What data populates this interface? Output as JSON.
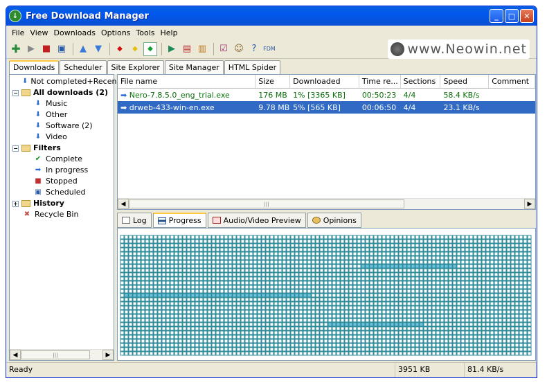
{
  "window": {
    "title": "Free Download Manager"
  },
  "menu": [
    "File",
    "View",
    "Downloads",
    "Options",
    "Tools",
    "Help"
  ],
  "watermark": "www.Neowin.net",
  "tabs": [
    "Downloads",
    "Scheduler",
    "Site Explorer",
    "Site Manager",
    "HTML Spider"
  ],
  "tree": [
    {
      "label": "Not completed+Recen",
      "icon": "download-arrow-icon",
      "level": 1,
      "bold": false
    },
    {
      "label": "All downloads (2)",
      "icon": "folder-icon",
      "level": 0,
      "bold": true,
      "expander": "−"
    },
    {
      "label": "Music",
      "icon": "download-arrow-icon",
      "level": 2,
      "bold": false
    },
    {
      "label": "Other",
      "icon": "download-arrow-icon",
      "level": 2,
      "bold": false
    },
    {
      "label": "Software (2)",
      "icon": "download-arrow-icon",
      "level": 2,
      "bold": false
    },
    {
      "label": "Video",
      "icon": "download-arrow-icon",
      "level": 2,
      "bold": false
    },
    {
      "label": "Filters",
      "icon": "folder-icon",
      "level": 0,
      "bold": true,
      "expander": "−"
    },
    {
      "label": "Complete",
      "icon": "checkmark-icon",
      "level": 2,
      "bold": false
    },
    {
      "label": "In progress",
      "icon": "progress-arrow-icon",
      "level": 2,
      "bold": false
    },
    {
      "label": "Stopped",
      "icon": "stop-icon",
      "level": 2,
      "bold": false
    },
    {
      "label": "Scheduled",
      "icon": "scheduled-icon",
      "level": 2,
      "bold": false
    },
    {
      "label": "History",
      "icon": "folder-icon",
      "level": 0,
      "bold": true,
      "expander": "+"
    },
    {
      "label": "Recycle Bin",
      "icon": "recycle-bin-icon",
      "level": 1,
      "bold": false
    }
  ],
  "grid": {
    "headers": [
      "File name",
      "Size",
      "Downloaded",
      "Time re...",
      "Sections",
      "Speed",
      "Comment"
    ],
    "rows": [
      {
        "cells": [
          "Nero-7.8.5.0_eng_trial.exe",
          "176 MB",
          "1% [3365 KB]",
          "00:50:23",
          "4/4",
          "58.4 KB/s",
          ""
        ],
        "state": "green"
      },
      {
        "cells": [
          "drweb-433-win-en.exe",
          "9.78 MB",
          "5% [565 KB]",
          "00:06:50",
          "4/4",
          "23.1 KB/s",
          ""
        ],
        "state": "sel"
      }
    ]
  },
  "bottom_tabs": [
    "Log",
    "Progress",
    "Audio/Video Preview",
    "Opinions"
  ],
  "status": {
    "text": "Ready",
    "size": "3951 KB",
    "speed": "81.4 KB/s"
  },
  "colors": {
    "accent": "#316ac5",
    "grid_cell": "#2e8b9a",
    "downloaded_cell": "#6fc5e0"
  }
}
